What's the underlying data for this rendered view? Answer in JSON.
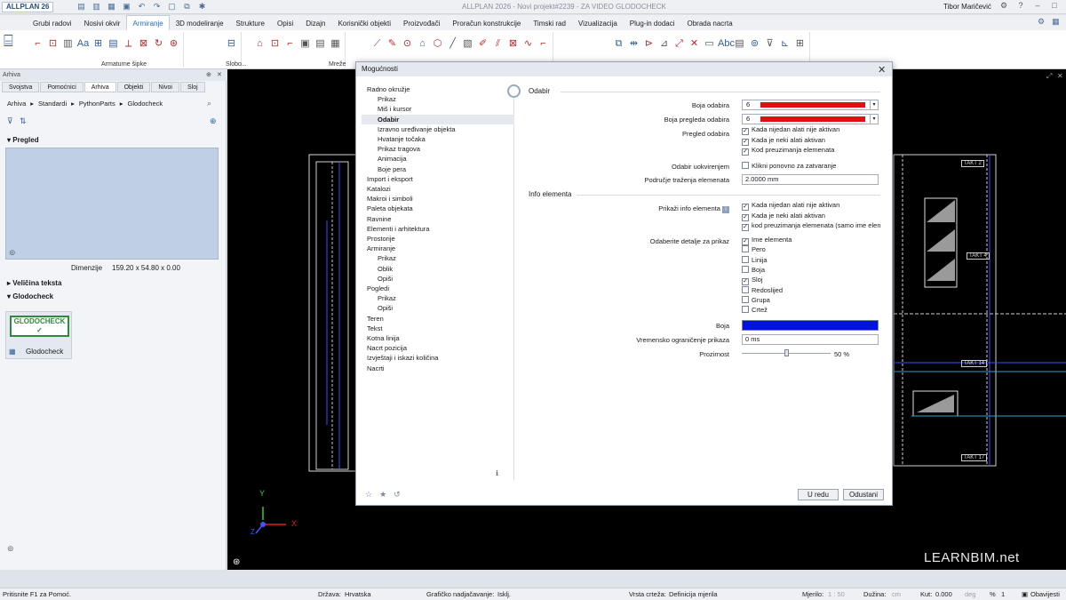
{
  "app": {
    "badge": "ALLPLAN 26",
    "window_title": "ALLPLAN 2026 - Novi projekt#2239 - ZA VIDEO GLODOCHECK",
    "user": "Tibor Maričević"
  },
  "ribbon": {
    "tabs": [
      "Grubi radovi",
      "Nosivi okvir",
      "Armiranje",
      "3D modeliranje",
      "Strukture",
      "Opisi",
      "Dizajn",
      "Korisnički objekti",
      "Proizvođači",
      "Proračun konstrukcije",
      "Timski rad",
      "Vizualizacija",
      "Plug-in dodaci",
      "Obrada nacrta"
    ],
    "active_tab": "Armiranje",
    "group_labels": {
      "g1": "Armaturne šipke",
      "g2": "Slobo...",
      "g3": "Mreže"
    }
  },
  "palette": {
    "header": "Arhiva",
    "tabs": [
      "Svojstva",
      "Pomoćnici",
      "Arhiva",
      "Objekti",
      "Nivoi",
      "Sloj"
    ],
    "active_tab": "Arhiva",
    "breadcrumb": [
      "Arhiva",
      "Standardi",
      "PythonParts",
      "Glodocheck"
    ],
    "section_preview": "Pregled",
    "dimensions_label": "Dimenzije",
    "dimensions_value": "159.20 x 54.80 x 0.00",
    "section_text_size": "Veličina teksta",
    "section_glodo": "Glodocheck",
    "glodo_logo": "GLODOCHECK",
    "glodo_item": "Glodocheck"
  },
  "canvas": {
    "watermark": "LEARNBIM.net",
    "takt_labels": [
      "TAKT 2",
      "TAKT 4",
      "TAKT 14",
      "TAKT 17"
    ],
    "axis_y": "Y",
    "axis_x": "X",
    "axis_z": "Z"
  },
  "dialog": {
    "title": "Mogućnosti",
    "nav": [
      {
        "label": "Radno okružje",
        "level": 0
      },
      {
        "label": "Prikaz",
        "level": 1
      },
      {
        "label": "Miš i kursor",
        "level": 1
      },
      {
        "label": "Odabir",
        "level": 1,
        "selected": true
      },
      {
        "label": "Izravno uređivanje objekta",
        "level": 1
      },
      {
        "label": "Hvatanje točaka",
        "level": 1
      },
      {
        "label": "Prikaz tragova",
        "level": 1
      },
      {
        "label": "Animacija",
        "level": 1
      },
      {
        "label": "Boje pera",
        "level": 1
      },
      {
        "label": "Import i eksport",
        "level": 0
      },
      {
        "label": "Katalozi",
        "level": 0
      },
      {
        "label": "Makroi i simboli",
        "level": 0
      },
      {
        "label": "Paleta objekata",
        "level": 0
      },
      {
        "label": "Ravnine",
        "level": 0
      },
      {
        "label": "Elementi i arhitektura",
        "level": 0
      },
      {
        "label": "Prostorije",
        "level": 0
      },
      {
        "label": "Armiranje",
        "level": 0
      },
      {
        "label": "Prikaz",
        "level": 1
      },
      {
        "label": "Oblik",
        "level": 1
      },
      {
        "label": "Opiši",
        "level": 1
      },
      {
        "label": "Pogledi",
        "level": 0
      },
      {
        "label": "Prikaz",
        "level": 1
      },
      {
        "label": "Opiši",
        "level": 1
      },
      {
        "label": "Teren",
        "level": 0
      },
      {
        "label": "Tekst",
        "level": 0
      },
      {
        "label": "Kotna linija",
        "level": 0
      },
      {
        "label": "Nacrt pozicija",
        "level": 0
      },
      {
        "label": "Izvještaji i iskazi količina",
        "level": 0
      },
      {
        "label": "Nacrti",
        "level": 0
      }
    ],
    "section_odabir": "Odabir",
    "boja_odabira_label": "Boja odabira",
    "boja_odabira_value": "6",
    "boja_pregleda_label": "Boja pregleda odabira",
    "boja_pregleda_value": "6",
    "pregled_odabira_label": "Pregled odabira",
    "pregled_checks": [
      {
        "label": "Kada nijedan alati nije aktivan",
        "checked": true
      },
      {
        "label": "Kada je neki alati aktivan",
        "checked": true
      },
      {
        "label": "Kod preuzimanja elemenata",
        "checked": true
      }
    ],
    "odabir_uokvirenjem_label": "Odabir uokvirenjem",
    "klikni_ponovno": {
      "label": "Klikni ponovno za zatvaranje",
      "checked": false
    },
    "podrucje_label": "Područje traženja elemenata",
    "podrucje_value": "2.0000 mm",
    "section_info": "Info elementa",
    "prikazi_info_label": "Prikaži info elementa",
    "info_checks": [
      {
        "label": "Kada nijedan alati nije aktivan",
        "checked": true
      },
      {
        "label": "Kada je neki alati aktivan",
        "checked": true
      },
      {
        "label": "kod preuzimanja elemenata (samo ime elen",
        "checked": true
      }
    ],
    "detalji_label": "Odaberite detalje za prikaz",
    "detalji_checks": [
      {
        "label": "Ime elementa",
        "checked": true
      },
      {
        "label": "Pero",
        "checked": false
      },
      {
        "label": "Linija",
        "checked": false
      },
      {
        "label": "Boja",
        "checked": false
      },
      {
        "label": "Sloj",
        "checked": true
      },
      {
        "label": "Redoslijed",
        "checked": false
      },
      {
        "label": "Grupa",
        "checked": false
      },
      {
        "label": "Crtež",
        "checked": false
      }
    ],
    "boja_label": "Boja",
    "boja_color": "#0014d8",
    "vremensko_label": "Vremensko ograničenje prikaza",
    "vremensko_value": "0 ms",
    "prozirnost_label": "Prozirnost",
    "prozirnost_value": "50 %",
    "prozirnost_level": 0.5,
    "ok_label": "U redu",
    "cancel_label": "Odustani"
  },
  "status": {
    "hint": "Pritisnite F1 za Pomoć.",
    "drzava_label": "Država:",
    "drzava_value": "Hrvatska",
    "graficko_label": "Grafičko nadjačavanje:",
    "graficko_value": "Isklj.",
    "vrsta_label": "Vrsta crteža:",
    "vrsta_value": "Definicija mjerila",
    "mjerilo_label": "Mjerilo:",
    "mjerilo_value": "1 : 50",
    "duzina_label": "Dužina:",
    "duzina_value": "cm",
    "kut_label": "Kut:",
    "kut_value": "0.000",
    "kut_unit": "deg",
    "pct": "%",
    "pct_value": "1",
    "obavijesti": "Obavijesti"
  },
  "colors": {
    "selection_red": "#e01010",
    "accent": "#1f6fb8"
  }
}
